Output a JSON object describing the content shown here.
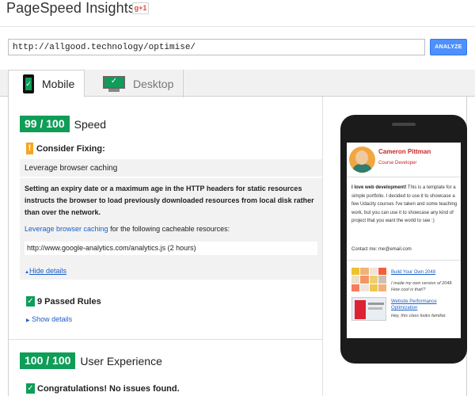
{
  "header": {
    "title": "PageSpeed Insights",
    "gplus_label": "g+1"
  },
  "url_bar": {
    "value": "http://allgood.technology/optimise/",
    "analyze_label": "ANALYZE"
  },
  "tabs": [
    {
      "label": "Mobile",
      "icon": "mobile-phone-check-icon",
      "active": true
    },
    {
      "label": "Desktop",
      "icon": "desktop-monitor-check-icon",
      "active": false
    }
  ],
  "speed": {
    "score": "99 / 100",
    "label": "Speed",
    "consider_fixing": "Consider Fixing:",
    "rule": {
      "title": "Leverage browser caching",
      "description": "Setting an expiry date or a maximum age in the HTTP headers for static resources instructs the browser to load previously downloaded resources from local disk rather than over the network.",
      "link_text": "Leverage browser caching",
      "link_suffix": " for the following cacheable resources:",
      "resource": "http://www.google-analytics.com/analytics.js (2 hours)",
      "hide_details": "Hide details"
    },
    "passed_rules": "9 Passed Rules",
    "show_details": "Show details"
  },
  "user_experience": {
    "score": "100 / 100",
    "label": "User Experience",
    "congrats": "Congratulations! No issues found."
  },
  "preview": {
    "name": "Cameron Pittman",
    "role": "Course Developer",
    "bio_bold": "I love web development!",
    "bio_rest": " This is a template for a simple portfolio. I decided to use it to showcase a few Udacity courses I've taken and some teaching work, but you can use it to showcase any kind of project that you want the world to see :)",
    "contact": "Contact me: me@email.com",
    "projects": [
      {
        "title": "Build Your Own 2048",
        "note": "I made my own version of 2048. How cool is that!?"
      },
      {
        "title": "Website Performance Optimization",
        "note": "Hey, this class looks familiar."
      }
    ]
  },
  "colors": {
    "score_green": "#0f9d58",
    "warning_orange": "#f5a623",
    "link_blue": "#1a5fc8",
    "analyze_blue": "#4d90fe",
    "name_red": "#c62828"
  }
}
